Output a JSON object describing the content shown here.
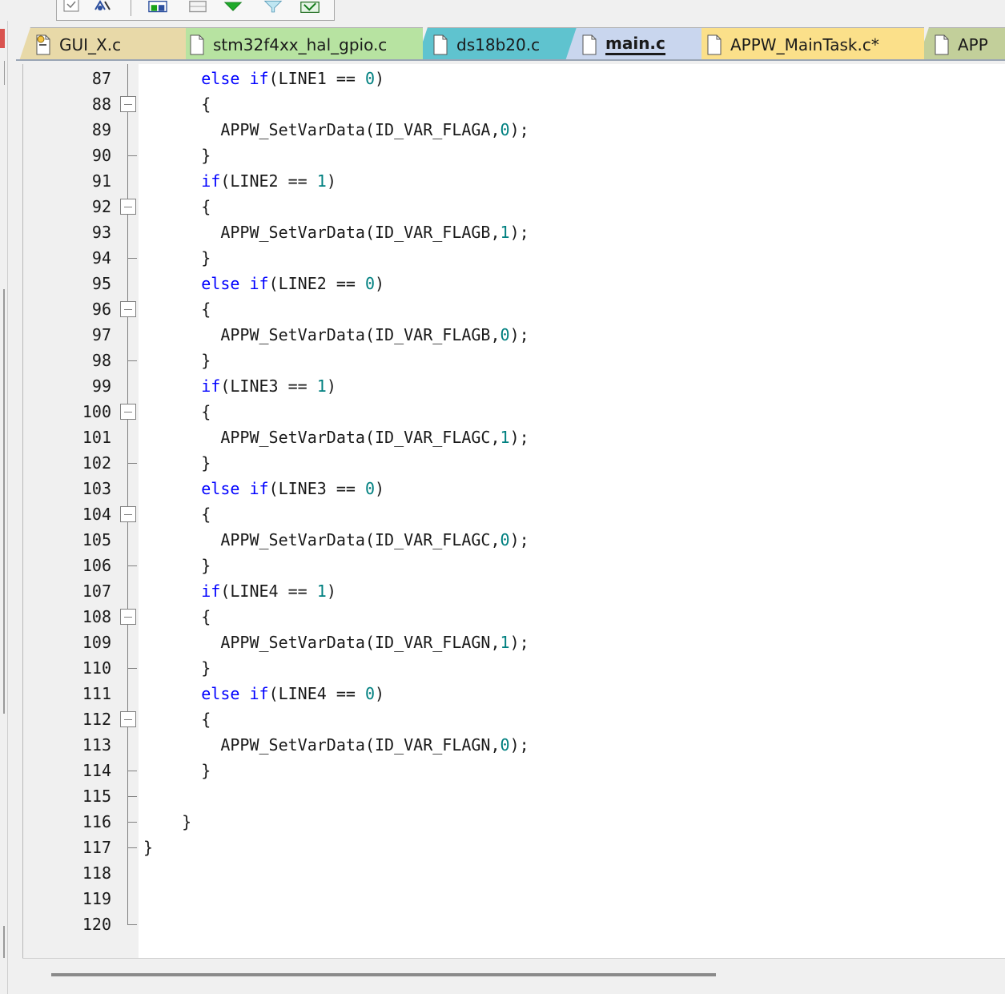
{
  "toolbar": {
    "icons": [
      "checkbox-icon",
      "debug-icon",
      "window-icon",
      "copy-window-icon",
      "green-diamond-icon",
      "filter-icon",
      "image-check-icon"
    ]
  },
  "tabs": [
    {
      "label": "GUI_X.c",
      "color": "#e8d9a8",
      "icon": "config-file-icon",
      "active": false
    },
    {
      "label": "stm32f4xx_hal_gpio.c",
      "color": "#b7e3a1",
      "icon": "file-icon",
      "active": false
    },
    {
      "label": "ds18b20.c",
      "color": "#5fc3cf",
      "icon": "file-icon",
      "active": false
    },
    {
      "label": "main.c",
      "color": "#c9d6ee",
      "icon": "file-icon",
      "active": true
    },
    {
      "label": "APPW_MainTask.c*",
      "color": "#fbe08a",
      "icon": "file-icon",
      "active": false
    },
    {
      "label": "APP",
      "color": "#c2cf9a",
      "icon": "file-icon",
      "active": false
    }
  ],
  "editor": {
    "lines": [
      {
        "n": "87",
        "fold": "none",
        "code": [
          [
            "      ",
            ""
          ],
          [
            "else",
            "kw"
          ],
          [
            " ",
            ""
          ],
          [
            "if",
            "kw"
          ],
          [
            "(LINE1 == ",
            ""
          ],
          [
            "0",
            "num"
          ],
          [
            ")",
            ""
          ]
        ]
      },
      {
        "n": "88",
        "fold": "box",
        "code": [
          [
            "      {",
            ""
          ]
        ]
      },
      {
        "n": "89",
        "fold": "none",
        "code": [
          [
            "        APPW_SetVarData(ID_VAR_FLAGA,",
            ""
          ],
          [
            "0",
            "num"
          ],
          [
            ");",
            ""
          ]
        ]
      },
      {
        "n": "90",
        "fold": "end",
        "code": [
          [
            "      }",
            ""
          ]
        ]
      },
      {
        "n": "91",
        "fold": "none",
        "code": [
          [
            "      ",
            ""
          ],
          [
            "if",
            "kw"
          ],
          [
            "(LINE2 == ",
            ""
          ],
          [
            "1",
            "num"
          ],
          [
            ")",
            ""
          ]
        ]
      },
      {
        "n": "92",
        "fold": "box",
        "code": [
          [
            "      {",
            ""
          ]
        ]
      },
      {
        "n": "93",
        "fold": "none",
        "code": [
          [
            "        APPW_SetVarData(ID_VAR_FLAGB,",
            ""
          ],
          [
            "1",
            "num"
          ],
          [
            ");",
            ""
          ]
        ]
      },
      {
        "n": "94",
        "fold": "end",
        "code": [
          [
            "      }",
            ""
          ]
        ]
      },
      {
        "n": "95",
        "fold": "none",
        "code": [
          [
            "      ",
            ""
          ],
          [
            "else",
            "kw"
          ],
          [
            " ",
            ""
          ],
          [
            "if",
            "kw"
          ],
          [
            "(LINE2 == ",
            ""
          ],
          [
            "0",
            "num"
          ],
          [
            ")",
            ""
          ]
        ]
      },
      {
        "n": "96",
        "fold": "box",
        "code": [
          [
            "      {",
            ""
          ]
        ]
      },
      {
        "n": "97",
        "fold": "none",
        "code": [
          [
            "        APPW_SetVarData(ID_VAR_FLAGB,",
            ""
          ],
          [
            "0",
            "num"
          ],
          [
            ");",
            ""
          ]
        ]
      },
      {
        "n": "98",
        "fold": "end",
        "code": [
          [
            "      }",
            ""
          ]
        ]
      },
      {
        "n": "99",
        "fold": "none",
        "code": [
          [
            "      ",
            ""
          ],
          [
            "if",
            "kw"
          ],
          [
            "(LINE3 == ",
            ""
          ],
          [
            "1",
            "num"
          ],
          [
            ")",
            ""
          ]
        ]
      },
      {
        "n": "100",
        "fold": "box",
        "code": [
          [
            "      {",
            ""
          ]
        ]
      },
      {
        "n": "101",
        "fold": "none",
        "code": [
          [
            "        APPW_SetVarData(ID_VAR_FLAGC,",
            ""
          ],
          [
            "1",
            "num"
          ],
          [
            ");",
            ""
          ]
        ]
      },
      {
        "n": "102",
        "fold": "end",
        "code": [
          [
            "      }",
            ""
          ]
        ]
      },
      {
        "n": "103",
        "fold": "none",
        "code": [
          [
            "      ",
            ""
          ],
          [
            "else",
            "kw"
          ],
          [
            " ",
            ""
          ],
          [
            "if",
            "kw"
          ],
          [
            "(LINE3 == ",
            ""
          ],
          [
            "0",
            "num"
          ],
          [
            ")",
            ""
          ]
        ]
      },
      {
        "n": "104",
        "fold": "box",
        "code": [
          [
            "      {",
            ""
          ]
        ]
      },
      {
        "n": "105",
        "fold": "none",
        "code": [
          [
            "        APPW_SetVarData(ID_VAR_FLAGC,",
            ""
          ],
          [
            "0",
            "num"
          ],
          [
            ");",
            ""
          ]
        ]
      },
      {
        "n": "106",
        "fold": "end",
        "code": [
          [
            "      }",
            ""
          ]
        ]
      },
      {
        "n": "107",
        "fold": "none",
        "code": [
          [
            "      ",
            ""
          ],
          [
            "if",
            "kw"
          ],
          [
            "(LINE4 == ",
            ""
          ],
          [
            "1",
            "num"
          ],
          [
            ")",
            ""
          ]
        ]
      },
      {
        "n": "108",
        "fold": "box",
        "code": [
          [
            "      {",
            ""
          ]
        ]
      },
      {
        "n": "109",
        "fold": "none",
        "code": [
          [
            "        APPW_SetVarData(ID_VAR_FLAGN,",
            ""
          ],
          [
            "1",
            "num"
          ],
          [
            ");",
            ""
          ]
        ]
      },
      {
        "n": "110",
        "fold": "end",
        "code": [
          [
            "      }",
            ""
          ]
        ]
      },
      {
        "n": "111",
        "fold": "none",
        "code": [
          [
            "      ",
            ""
          ],
          [
            "else",
            "kw"
          ],
          [
            " ",
            ""
          ],
          [
            "if",
            "kw"
          ],
          [
            "(LINE4 == ",
            ""
          ],
          [
            "0",
            "num"
          ],
          [
            ")",
            ""
          ]
        ]
      },
      {
        "n": "112",
        "fold": "box",
        "code": [
          [
            "      {",
            ""
          ]
        ]
      },
      {
        "n": "113",
        "fold": "none",
        "code": [
          [
            "        APPW_SetVarData(ID_VAR_FLAGN,",
            ""
          ],
          [
            "0",
            "num"
          ],
          [
            ");",
            ""
          ]
        ]
      },
      {
        "n": "114",
        "fold": "end",
        "code": [
          [
            "      }",
            ""
          ]
        ]
      },
      {
        "n": "115",
        "fold": "end",
        "code": [
          [
            "",
            ""
          ]
        ]
      },
      {
        "n": "116",
        "fold": "end",
        "code": [
          [
            "    }",
            ""
          ]
        ]
      },
      {
        "n": "117",
        "fold": "end",
        "code": [
          [
            "}",
            ""
          ]
        ]
      },
      {
        "n": "118",
        "fold": "none",
        "code": [
          [
            "",
            ""
          ]
        ]
      },
      {
        "n": "119",
        "fold": "none",
        "code": [
          [
            "",
            ""
          ]
        ]
      },
      {
        "n": "120",
        "fold": "end",
        "code": [
          [
            "",
            ""
          ]
        ]
      }
    ]
  },
  "colors": {
    "keyword": "#0000ff",
    "number": "#008080",
    "text": "#1a1a1a",
    "gutter": "#f0f0f0"
  }
}
